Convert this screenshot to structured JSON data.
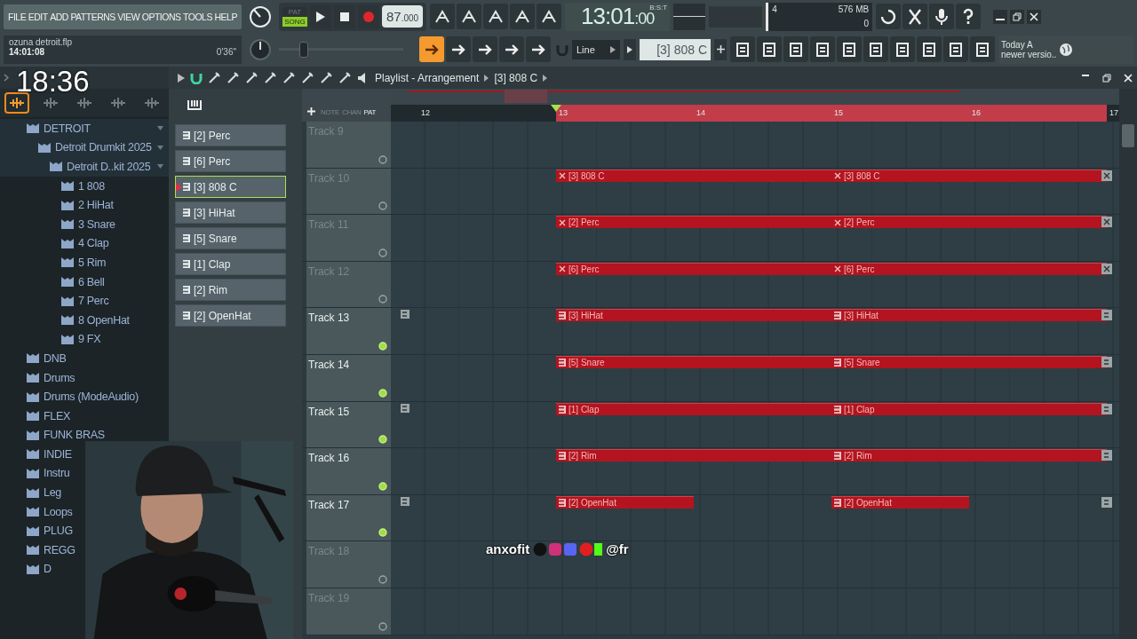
{
  "menu": [
    "FILE",
    "EDIT",
    "ADD",
    "PATTERNS",
    "VIEW",
    "OPTIONS",
    "TOOLS",
    "HELP"
  ],
  "modes": [
    {
      "label": "PAT",
      "selected": false
    },
    {
      "label": "SONG",
      "selected": true
    }
  ],
  "tempo": {
    "whole": "87",
    "decimals": ".000"
  },
  "clock": {
    "time": "13:01",
    "sub": ":00",
    "format": "B:S:T"
  },
  "meters": {
    "polyphony": "4",
    "memory": "576 MB",
    "voices": "0"
  },
  "project": {
    "file": "ozuna detroit.flp",
    "time": "14:01:08",
    "length": "0'36\""
  },
  "pitch": {
    "level": 0.2
  },
  "snap": "Line",
  "pattern_selector": "[3] 808 C",
  "news": {
    "line1": "Today  A",
    "line2": "newer versio.."
  },
  "overlay": {
    "clock": "18:36",
    "handle": "anxofit",
    "handle2": "@fr"
  },
  "playlist": {
    "title": "Playlist - Arrangement",
    "pattern": "[3] 808 C",
    "filters": [
      {
        "label": "NOTE",
        "selected": false
      },
      {
        "label": "CHAN",
        "selected": false
      },
      {
        "label": "PAT",
        "selected": true
      }
    ]
  },
  "browser": {
    "tabs": [
      {
        "selected": true
      },
      {
        "selected": false
      },
      {
        "selected": false
      },
      {
        "selected": false
      },
      {
        "selected": false
      }
    ],
    "tree": [
      {
        "label": "DETROIT",
        "expanded": true,
        "children": [
          {
            "label": "Detroit Drumkit 2025",
            "expanded": true,
            "children": [
              {
                "label": "Detroit D..kit 2025",
                "expanded": true,
                "children": [
                  {
                    "label": "1 808",
                    "expanded": false
                  },
                  {
                    "label": "2 HiHat",
                    "expanded": false
                  },
                  {
                    "label": "3 Snare",
                    "expanded": false
                  },
                  {
                    "label": "4 Clap",
                    "expanded": false
                  },
                  {
                    "label": "5 Rim",
                    "expanded": false
                  },
                  {
                    "label": "6 Bell",
                    "expanded": false
                  },
                  {
                    "label": "7 Perc",
                    "expanded": false
                  },
                  {
                    "label": "8 OpenHat",
                    "expanded": false
                  },
                  {
                    "label": "9 FX",
                    "expanded": false
                  }
                ]
              }
            ]
          }
        ]
      },
      {
        "label": "DNB",
        "expanded": false
      },
      {
        "label": "Drums",
        "expanded": false
      },
      {
        "label": "Drums (ModeAudio)",
        "expanded": false
      },
      {
        "label": "FLEX",
        "expanded": false
      },
      {
        "label": "FUNK BRAS",
        "expanded": false
      },
      {
        "label": "INDIE",
        "expanded": false
      },
      {
        "label": "Instru",
        "expanded": false
      },
      {
        "label": "Leg",
        "expanded": false
      },
      {
        "label": "Loops",
        "expanded": false
      },
      {
        "label": "PLUG",
        "expanded": false
      },
      {
        "label": "REGG",
        "expanded": false
      },
      {
        "label": "D",
        "expanded": false
      }
    ]
  },
  "patterns": [
    {
      "label": "[2] Perc",
      "selected": false
    },
    {
      "label": "[6] Perc",
      "selected": false
    },
    {
      "label": "[3] 808 C",
      "selected": true
    },
    {
      "label": "[3] HiHat",
      "selected": false
    },
    {
      "label": "[5] Snare",
      "selected": false
    },
    {
      "label": "[1] Clap",
      "selected": false
    },
    {
      "label": "[2] Rim",
      "selected": false
    },
    {
      "label": "[2] OpenHat",
      "selected": false
    }
  ],
  "timeline": {
    "bars": [
      "12",
      "13",
      "14",
      "15",
      "16",
      "17"
    ]
  },
  "tracks": [
    {
      "name": "Track 9",
      "enabled": false,
      "marker": false
    },
    {
      "name": "Track 10",
      "enabled": false,
      "marker": false,
      "clips": [
        {
          "label": "[3] 808 C",
          "kind": "long"
        },
        {
          "label": "[3] 808 C",
          "kind": "long"
        }
      ]
    },
    {
      "name": "Track 11",
      "enabled": false,
      "marker": false,
      "clips": [
        {
          "label": "[2] Perc",
          "kind": "long"
        },
        {
          "label": "[2] Perc",
          "kind": "long"
        }
      ]
    },
    {
      "name": "Track 12",
      "enabled": false,
      "marker": false,
      "clips": [
        {
          "label": "[6] Perc",
          "kind": "long"
        },
        {
          "label": "[6] Perc",
          "kind": "long"
        }
      ]
    },
    {
      "name": "Track 13",
      "enabled": true,
      "marker": true,
      "clips": [
        {
          "label": "[3] HiHat",
          "kind": "long"
        },
        {
          "label": "[3] HiHat",
          "kind": "long"
        }
      ]
    },
    {
      "name": "Track 14",
      "enabled": true,
      "marker": false,
      "clips": [
        {
          "label": "[5] Snare",
          "kind": "long"
        },
        {
          "label": "[5] Snare",
          "kind": "long"
        }
      ]
    },
    {
      "name": "Track 15",
      "enabled": true,
      "marker": true,
      "clips": [
        {
          "label": "[1] Clap",
          "kind": "long"
        },
        {
          "label": "[1] Clap",
          "kind": "long"
        }
      ]
    },
    {
      "name": "Track 16",
      "enabled": true,
      "marker": false,
      "clips": [
        {
          "label": "[2] Rim",
          "kind": "long"
        },
        {
          "label": "[2] Rim",
          "kind": "long"
        }
      ]
    },
    {
      "name": "Track 17",
      "enabled": true,
      "marker": true,
      "clips": [
        {
          "label": "[2] OpenHat",
          "kind": "short"
        },
        {
          "label": "[2] OpenHat",
          "kind": "short"
        }
      ]
    },
    {
      "name": "Track 18",
      "enabled": false,
      "marker": false
    },
    {
      "name": "Track 19",
      "enabled": false,
      "marker": false
    }
  ]
}
